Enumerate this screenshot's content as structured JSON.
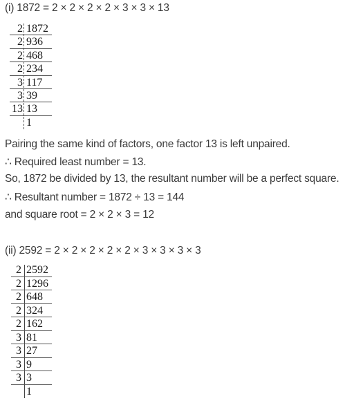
{
  "part1": {
    "heading": "(i) 1872 = 2 × 2 × 2 × 2 × 3 × 3 × 13",
    "division": [
      {
        "divisor": "2",
        "dividend": "1872"
      },
      {
        "divisor": "2",
        "dividend": "936"
      },
      {
        "divisor": "2",
        "dividend": "468"
      },
      {
        "divisor": "2",
        "dividend": "234"
      },
      {
        "divisor": "3",
        "dividend": "117"
      },
      {
        "divisor": "3",
        "dividend": "39"
      },
      {
        "divisor": "13",
        "dividend": "13"
      },
      {
        "divisor": "",
        "dividend": "1"
      }
    ],
    "lines": [
      "Pairing the same kind of factors, one factor 13 is left unpaired.",
      "∴ Required least number = 13.",
      "So, 1872 be divided by 13, the resultant number will be a perfect square.",
      "∴ Resultant number = 1872 ÷ 13 = 144",
      "and square root = 2 × 2 × 3 = 12"
    ]
  },
  "part2": {
    "heading": "(ii) 2592 = 2 × 2 × 2 × 2 × 2 × 3 × 3 × 3 × 3",
    "division": [
      {
        "divisor": "2",
        "dividend": "2592"
      },
      {
        "divisor": "2",
        "dividend": "1296"
      },
      {
        "divisor": "2",
        "dividend": "648"
      },
      {
        "divisor": "2",
        "dividend": "324"
      },
      {
        "divisor": "2",
        "dividend": "162"
      },
      {
        "divisor": "3",
        "dividend": "81"
      },
      {
        "divisor": "3",
        "dividend": "27"
      },
      {
        "divisor": "3",
        "dividend": "9"
      },
      {
        "divisor": "3",
        "dividend": "3"
      },
      {
        "divisor": "",
        "dividend": "1"
      }
    ]
  }
}
